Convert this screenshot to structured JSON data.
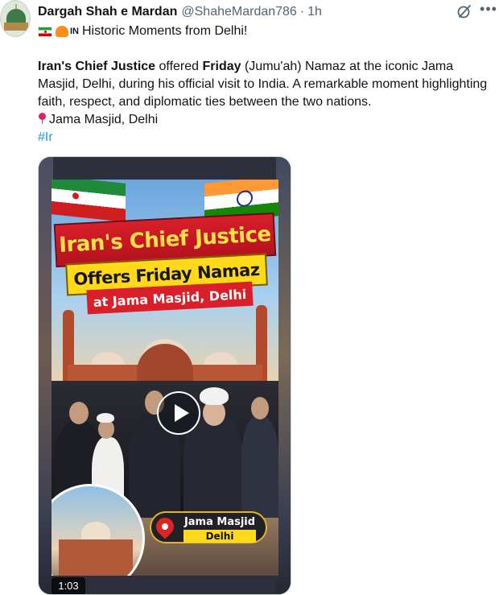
{
  "post": {
    "author_name": "Dargah Shah e Mardan",
    "handle": "@ShaheMardan786",
    "separator": "·",
    "time": "1h",
    "more_label": "•••",
    "headline_in": "IN",
    "headline_text": "Historic Moments from Delhi!",
    "body_bold_1": "Iran's Chief Justice",
    "body_text_1": " offered ",
    "body_bold_2": "Friday",
    "body_text_2": " (Jumu'ah) Namaz at the iconic Jama Masjid, Delhi, during his official visit to India. A remarkable moment highlighting faith, respect, and diplomatic ties between the two nations.",
    "location_line": "Jama Masjid, Delhi",
    "hashtag": "#Ir"
  },
  "media": {
    "poster_line1": "Iran's Chief Justice",
    "poster_line2": "Offers Friday Namaz",
    "poster_line3": "at Jama Masjid, Delhi",
    "badge_title": "Jama Masjid",
    "badge_subtitle": "Delhi",
    "duration": "1:03"
  },
  "colors": {
    "link": "#1d9bf0",
    "muted": "#536471"
  }
}
